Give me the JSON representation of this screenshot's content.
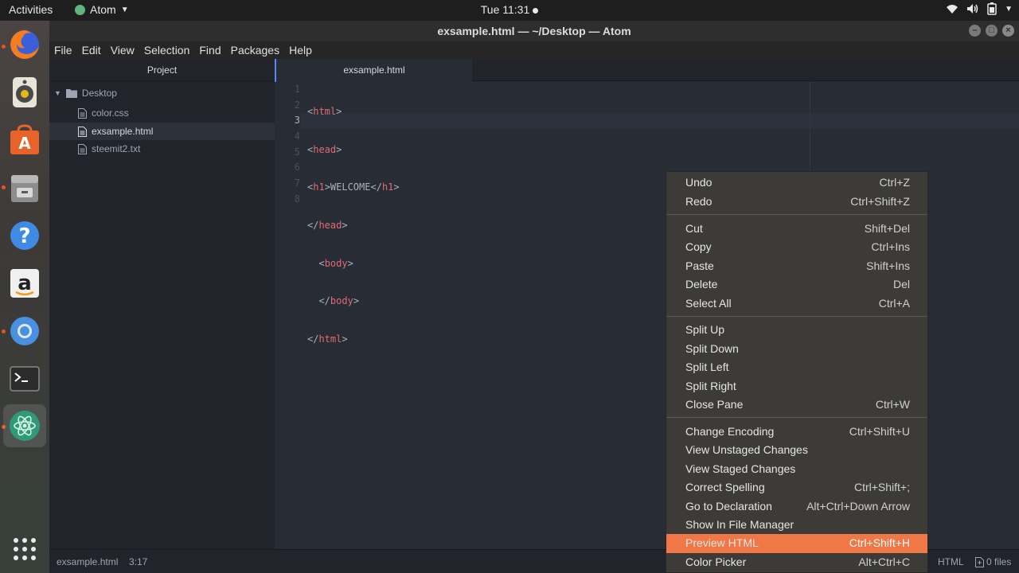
{
  "topbar": {
    "activities": "Activities",
    "app_name": "Atom",
    "clock": "Tue 11:31"
  },
  "dock": {
    "items": [
      {
        "name": "firefox-icon",
        "running": true
      },
      {
        "name": "rhythmbox-icon",
        "running": false
      },
      {
        "name": "software-center-icon",
        "running": false
      },
      {
        "name": "files-icon",
        "running": true
      },
      {
        "name": "help-icon",
        "running": false
      },
      {
        "name": "amazon-icon",
        "running": false
      },
      {
        "name": "chromium-icon",
        "running": true
      },
      {
        "name": "terminal-icon",
        "running": false
      },
      {
        "name": "atom-icon",
        "running": true
      },
      {
        "name": "show-applications-icon",
        "running": false
      }
    ]
  },
  "window": {
    "title": "exsample.html — ~/Desktop — Atom"
  },
  "menubar": [
    "File",
    "Edit",
    "View",
    "Selection",
    "Find",
    "Packages",
    "Help"
  ],
  "tree": {
    "title": "Project",
    "root": "Desktop",
    "files": [
      "color.css",
      "exsample.html",
      "steemit2.txt"
    ],
    "selected": "exsample.html"
  },
  "editor": {
    "tab_title": "exsample.html",
    "line_numbers": [
      "1",
      "2",
      "3",
      "4",
      "5",
      "6",
      "7",
      "8"
    ],
    "current_line": "3"
  },
  "statusbar": {
    "file": "exsample.html",
    "cursor": "3:17",
    "grammar": "HTML",
    "files_count": "0 files"
  },
  "context_menu": {
    "groups": [
      [
        {
          "label": "Undo",
          "accel": "Ctrl+Z"
        },
        {
          "label": "Redo",
          "accel": "Ctrl+Shift+Z"
        }
      ],
      [
        {
          "label": "Cut",
          "accel": "Shift+Del"
        },
        {
          "label": "Copy",
          "accel": "Ctrl+Ins"
        },
        {
          "label": "Paste",
          "accel": "Shift+Ins"
        },
        {
          "label": "Delete",
          "accel": "Del"
        },
        {
          "label": "Select All",
          "accel": "Ctrl+A"
        }
      ],
      [
        {
          "label": "Split Up",
          "accel": ""
        },
        {
          "label": "Split Down",
          "accel": ""
        },
        {
          "label": "Split Left",
          "accel": ""
        },
        {
          "label": "Split Right",
          "accel": ""
        },
        {
          "label": "Close Pane",
          "accel": "Ctrl+W"
        }
      ],
      [
        {
          "label": "Change Encoding",
          "accel": "Ctrl+Shift+U"
        },
        {
          "label": "View Unstaged Changes",
          "accel": ""
        },
        {
          "label": "View Staged Changes",
          "accel": ""
        },
        {
          "label": "Correct Spelling",
          "accel": "Ctrl+Shift+;"
        },
        {
          "label": "Go to Declaration",
          "accel": "Alt+Ctrl+Down Arrow"
        },
        {
          "label": "Show In File Manager",
          "accel": ""
        },
        {
          "label": "Preview HTML",
          "accel": "Ctrl+Shift+H",
          "highlighted": true
        },
        {
          "label": "Color Picker",
          "accel": "Alt+Ctrl+C"
        }
      ]
    ]
  },
  "colors": {
    "highlight": "#f07746",
    "menu_bg": "#3c3b37",
    "editor_bg": "#282c34",
    "tag": "#e06c75"
  }
}
